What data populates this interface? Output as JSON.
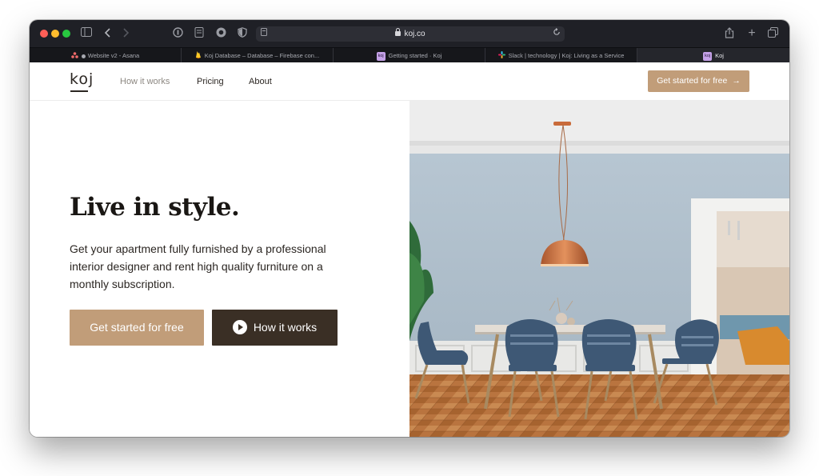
{
  "browser": {
    "url": "koj.co",
    "tabs": [
      {
        "label": "Website v2 - Asana",
        "icon": "asana-icon",
        "active": false
      },
      {
        "label": "Koj Database – Database – Firebase con...",
        "icon": "firebase-icon",
        "active": false
      },
      {
        "label": "Getting started · Koj",
        "icon": "koj-favicon",
        "active": false
      },
      {
        "label": "Slack | technology | Koj: Living as a Service",
        "icon": "slack-icon",
        "active": false
      },
      {
        "label": "Koj",
        "icon": "koj-favicon",
        "active": true
      }
    ],
    "favicon_text": "koj"
  },
  "site": {
    "logo": "koj",
    "nav": {
      "how_it_works": "How it works",
      "pricing": "Pricing",
      "about": "About",
      "cta": "Get started for free"
    },
    "hero": {
      "headline": "Live in style.",
      "subtitle": "Get your apartment fully furnished by a professional interior designer and rent high quality furniture on a monthly subscription.",
      "primary_cta": "Get started for free",
      "secondary_cta": "How it works"
    }
  },
  "colors": {
    "accent": "#c19d79",
    "dark_button": "#3a2f25",
    "text": "#1a1714",
    "toolbar": "#1f2026"
  }
}
